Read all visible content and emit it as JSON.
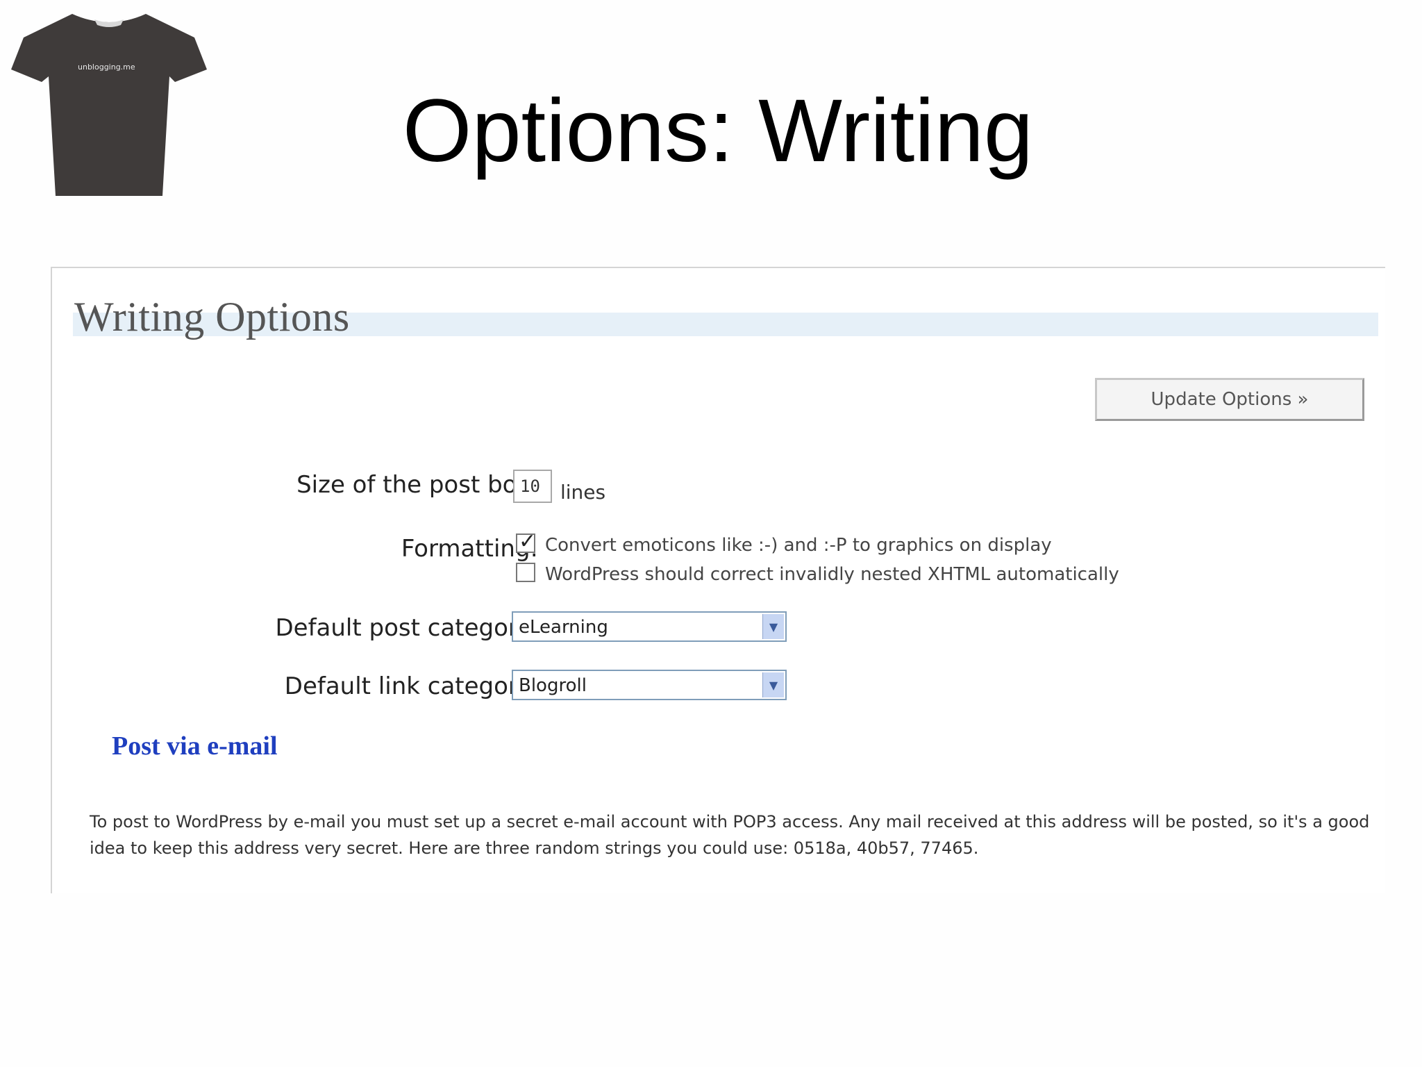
{
  "slide": {
    "title": "Options: Writing",
    "logo_text": "unblogging.me"
  },
  "panel": {
    "heading": "Writing Options",
    "update_button": "Update Options »",
    "post_box": {
      "label": "Size of the post box:",
      "value": "10",
      "unit": "lines"
    },
    "formatting": {
      "label": "Formatting:",
      "options": [
        {
          "label": "Convert emoticons like :-) and :-P to graphics on display",
          "checked": true
        },
        {
          "label": "WordPress should correct invalidly nested XHTML automatically",
          "checked": false
        }
      ]
    },
    "default_post_category": {
      "label": "Default post category:",
      "value": "eLearning"
    },
    "default_link_category": {
      "label": "Default link category:",
      "value": "Blogroll"
    },
    "post_via_email": {
      "title": "Post via e-mail",
      "description": "To post to WordPress by e-mail you must set up a secret e-mail account with POP3 access. Any mail received at this address will be posted, so it's a good idea to keep this address very secret. Here are three random strings you could use: 0518a, 40b57, 77465."
    }
  },
  "icons": {
    "dropdown": "chevron-down-icon",
    "check": "checkmark-icon"
  }
}
